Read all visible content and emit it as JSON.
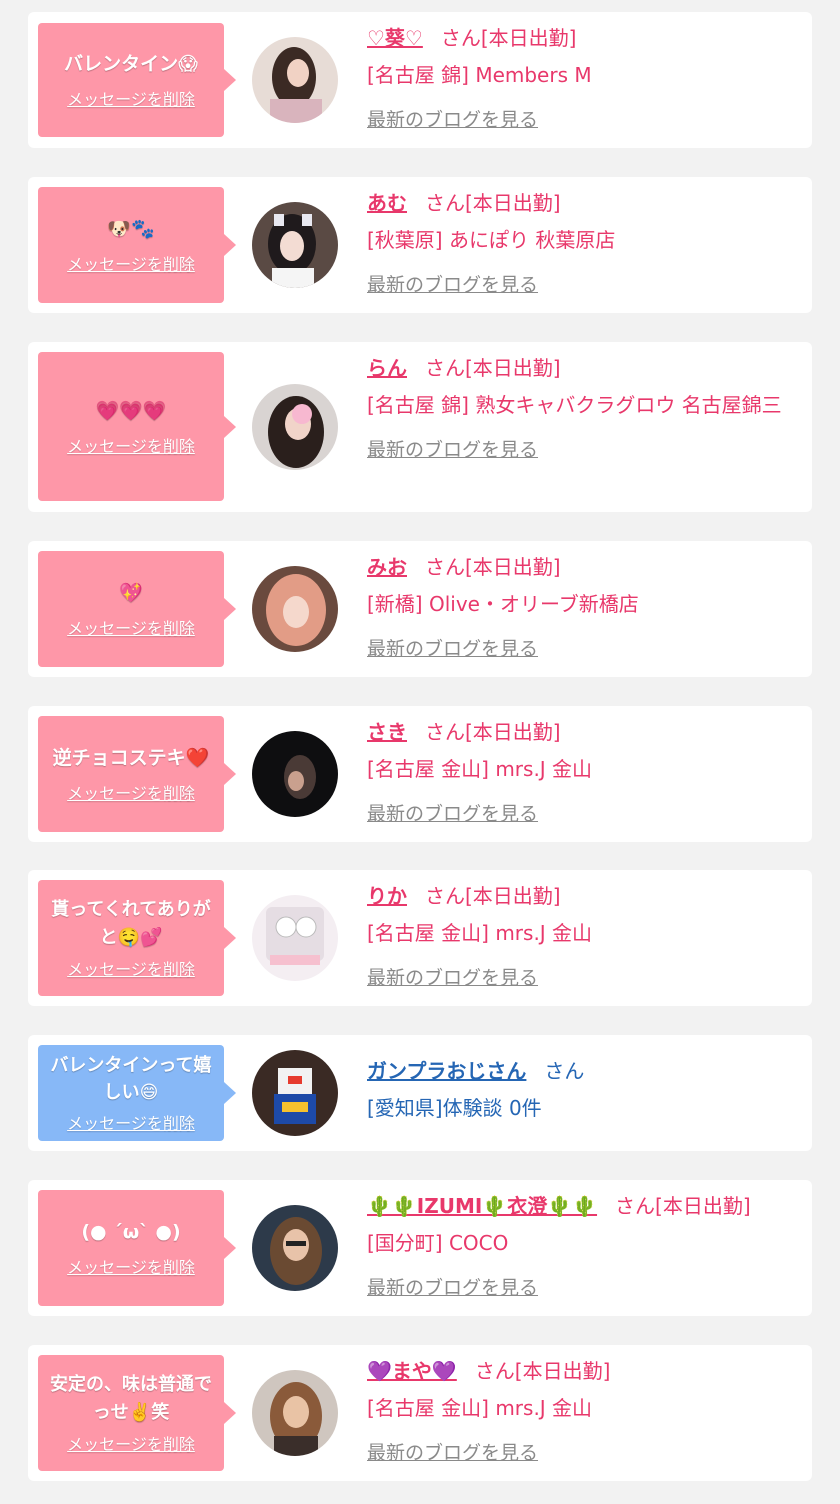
{
  "common": {
    "delete_label": "メッセージを削除",
    "blog_label": "最新のブログを見る"
  },
  "items": [
    {
      "message": "バレンタイン😱",
      "name": "♡葵♡",
      "suffix": "さん[本日出勤]",
      "shop": "[名古屋 錦] Members M",
      "bubble_color": "#fe97a8"
    },
    {
      "message": "🐶🐾",
      "name": "あむ",
      "suffix": "さん[本日出勤]",
      "shop": "[秋葉原] あにぽり 秋葉原店",
      "bubble_color": "#fe97a8"
    },
    {
      "message": "💗💗💗",
      "name": "らん",
      "suffix": "さん[本日出勤]",
      "shop": "[名古屋 錦] 熟女キャバクラグロウ 名古屋錦三",
      "bubble_color": "#fe97a8"
    },
    {
      "message": "💖",
      "name": "みお",
      "suffix": "さん[本日出勤]",
      "shop": "[新橋] Olive・オリーブ新橋店",
      "bubble_color": "#fe97a8"
    },
    {
      "message": "逆チョコステキ❤️",
      "name": "さき",
      "suffix": "さん[本日出勤]",
      "shop": "[名古屋 金山] mrs.J 金山",
      "bubble_color": "#fe97a8"
    },
    {
      "message": "貰ってくれてありがと🤤💕",
      "name": "りか",
      "suffix": "さん[本日出勤]",
      "shop": "[名古屋 金山] mrs.J 金山",
      "bubble_color": "#fe97a8"
    },
    {
      "message": "バレンタインって嬉しい😄",
      "name": "ガンプラおじさん",
      "suffix": "さん",
      "shop": "[愛知県]体験談 0件",
      "bubble_color": "#87b8f7"
    },
    {
      "message": "(● ´ω` ●)",
      "name": "🌵🌵IZUMI🌵衣澄🌵🌵",
      "suffix": "さん[本日出勤]",
      "shop": "[国分町] COCO",
      "bubble_color": "#fe97a8"
    },
    {
      "message": "安定の、味は普通でっせ✌️笑",
      "name": "💜まや💜",
      "suffix": "さん[本日出勤]",
      "shop": "[名古屋 金山] mrs.J 金山",
      "bubble_color": "#fe97a8"
    }
  ]
}
